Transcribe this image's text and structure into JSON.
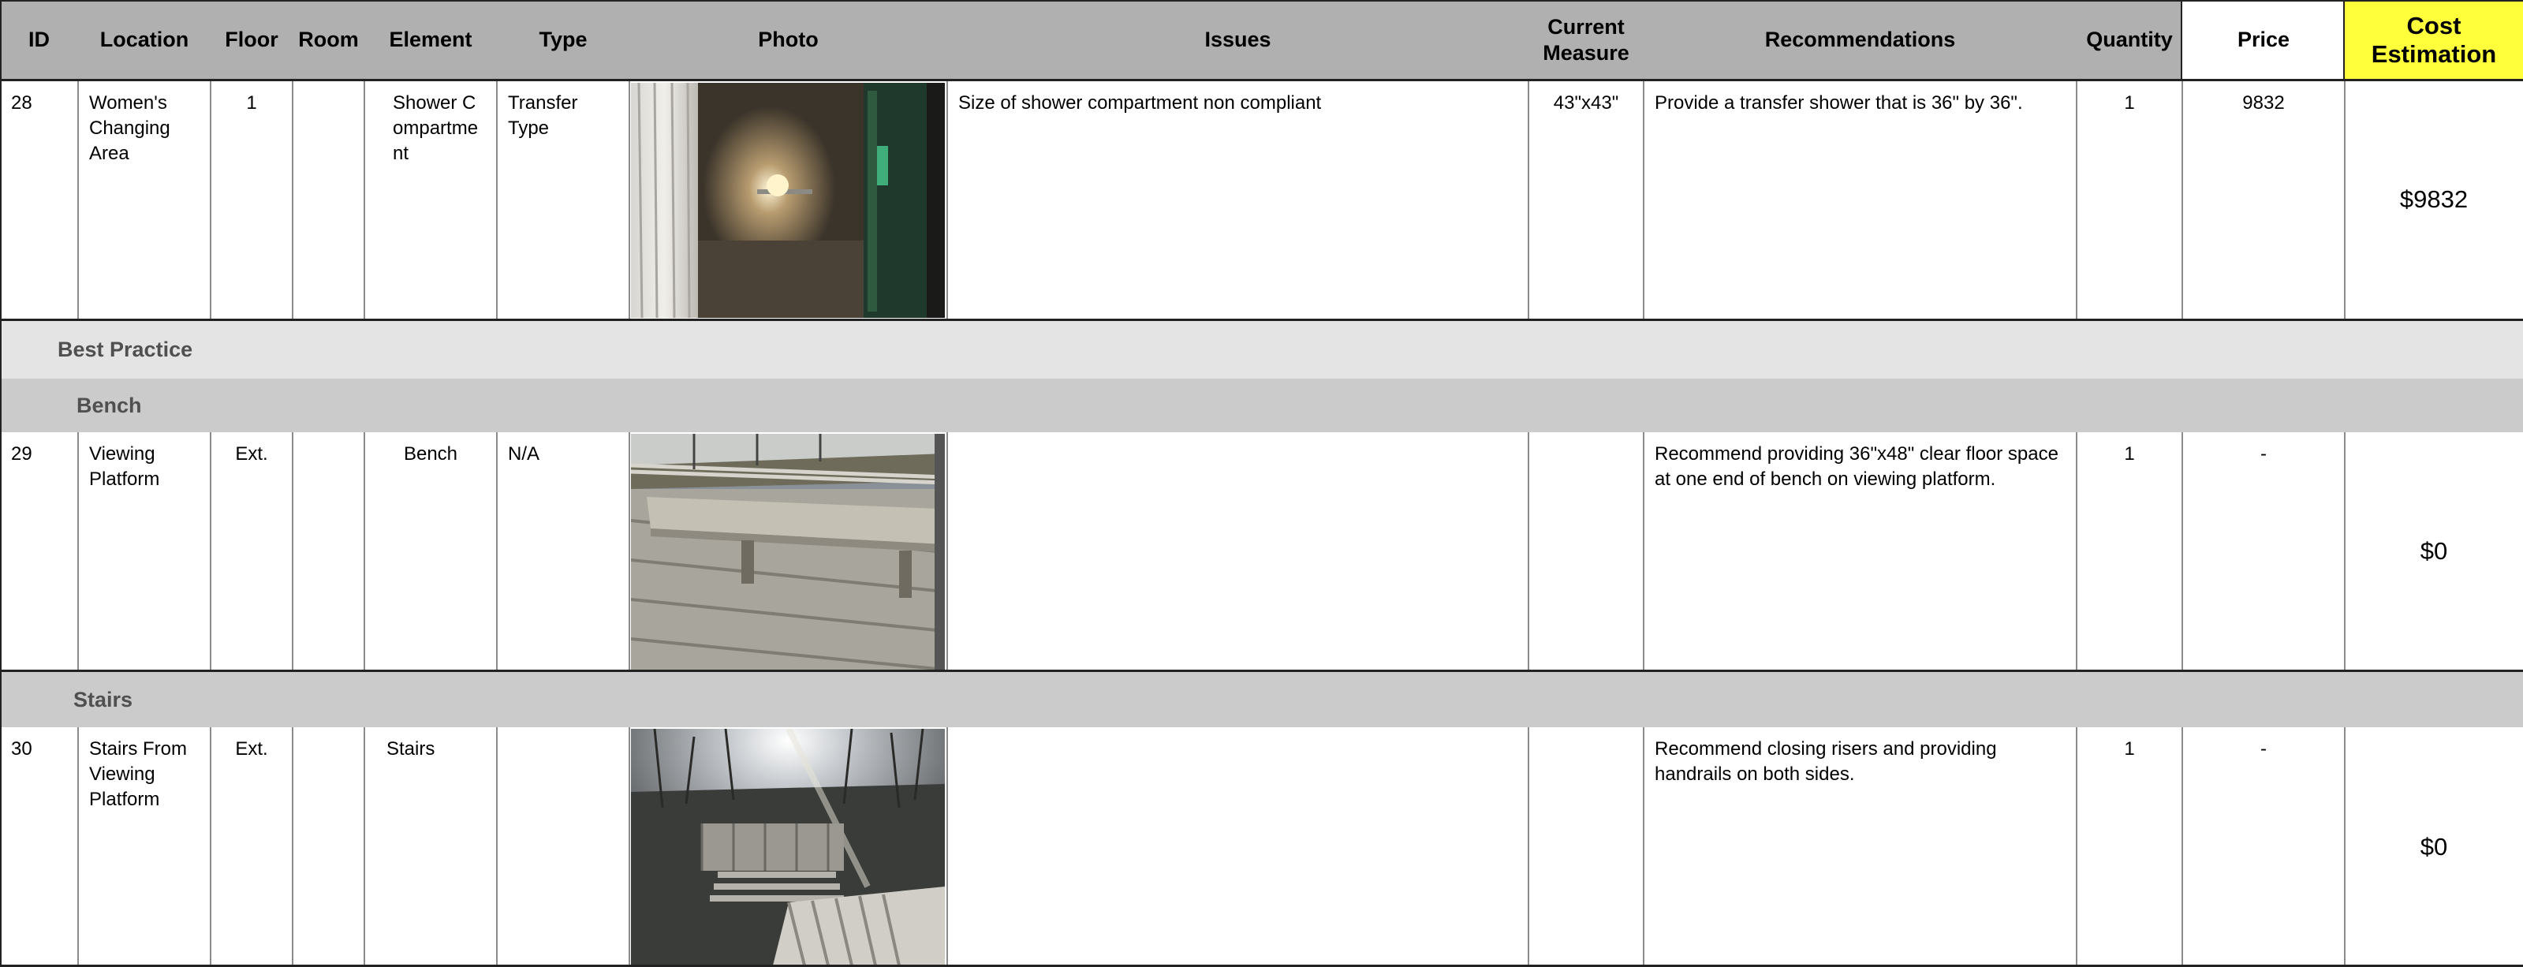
{
  "headers": {
    "id": "ID",
    "location": "Location",
    "floor": "Floor",
    "room": "Room",
    "element": "Element",
    "type": "Type",
    "photo": "Photo",
    "issues": "Issues",
    "current_measure": "Current Measure",
    "recommendations": "Recommendations",
    "quantity": "Quantity",
    "price": "Price",
    "cost_estimation": "Cost Estimation"
  },
  "rows": [
    {
      "id": "28",
      "location": "Women's Changing Area",
      "floor": "1",
      "room": "",
      "element": "Shower Compartment",
      "type": "Transfer Type",
      "issues": "Size of shower compartment non compliant",
      "current_measure": "43\"x43\"",
      "recommendations": "Provide a transfer shower that is 36\" by 36\".",
      "quantity": "1",
      "price": "9832",
      "cost": "$9832"
    },
    {
      "id": "29",
      "location": "Viewing Platform",
      "floor": "Ext.",
      "room": "",
      "element": "Bench",
      "type": "N/A",
      "issues": "",
      "current_measure": "",
      "recommendations": "Recommend providing 36\"x48\" clear floor space at one end of bench on viewing platform.",
      "quantity": "1",
      "price": "-",
      "cost": "$0"
    },
    {
      "id": "30",
      "location": "Stairs From Viewing Platform",
      "floor": "Ext.",
      "room": "",
      "element": "Stairs",
      "type": "",
      "issues": "",
      "current_measure": "",
      "recommendations": "Recommend closing risers and providing handrails on both sides.",
      "quantity": "1",
      "price": "-",
      "cost": "$0"
    }
  ],
  "sections": {
    "best_practice": "Best Practice",
    "bench": "Bench",
    "stairs": "Stairs"
  },
  "colors": {
    "header_bg": "#b0b0b0",
    "cost_header_bg": "#ffff3c",
    "band_light": "#e4e4e4",
    "band_dark": "#cbcbcb"
  }
}
